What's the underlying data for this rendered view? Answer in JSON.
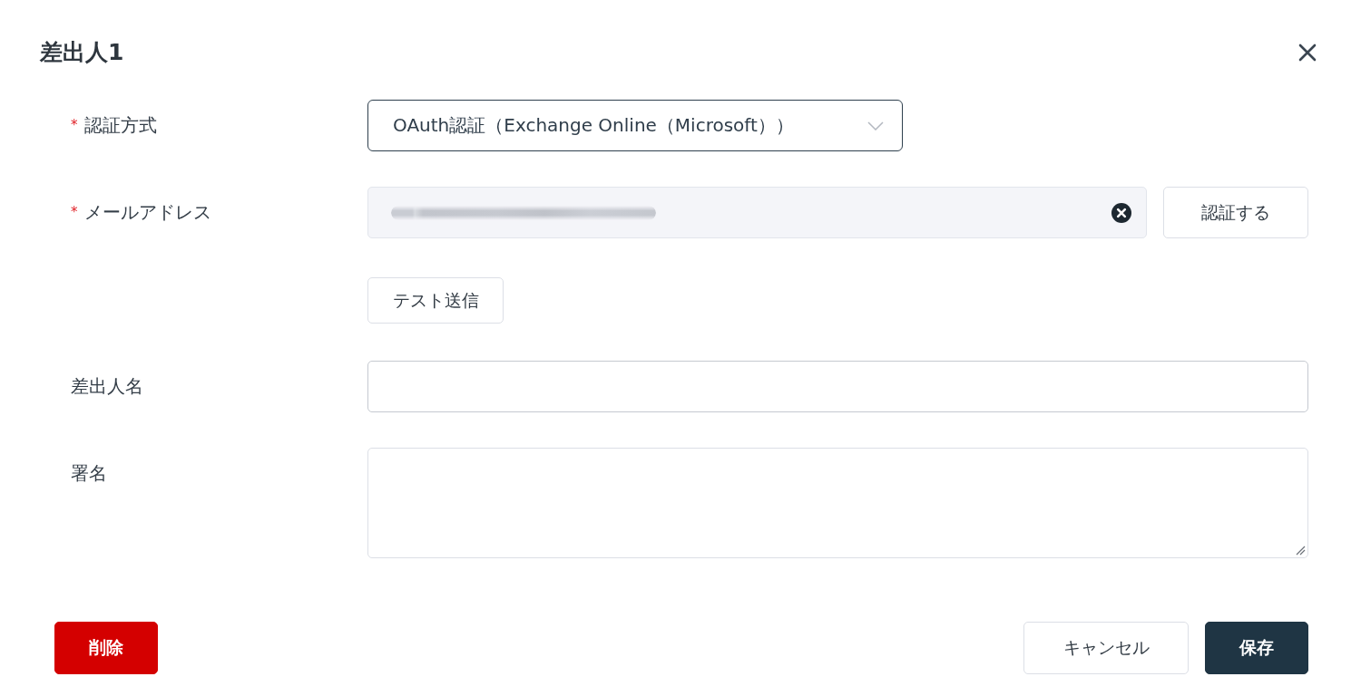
{
  "dialog": {
    "title": "差出人1"
  },
  "fields": [
    {
      "kind": "select",
      "label": "認証方式",
      "required_mark": "*",
      "value": "OAuth認証（Exchange Online（Microsoft））",
      "focused": true,
      "disabled": false
    },
    {
      "kind": "text",
      "label": "メールアドレス",
      "required_mark": "*",
      "redacted": true,
      "clearable": true,
      "action_button": "認証する",
      "focused": false,
      "disabled": true
    },
    {
      "kind": "button",
      "button": "テスト送信"
    },
    {
      "kind": "text",
      "label": "差出人名",
      "focused": false,
      "disabled": false
    },
    {
      "kind": "textarea",
      "label": "署名",
      "focused": false,
      "disabled": false
    }
  ],
  "footer": {
    "delete_button": "削除",
    "cancel_button": "キャンセル",
    "save_button": "保存"
  }
}
